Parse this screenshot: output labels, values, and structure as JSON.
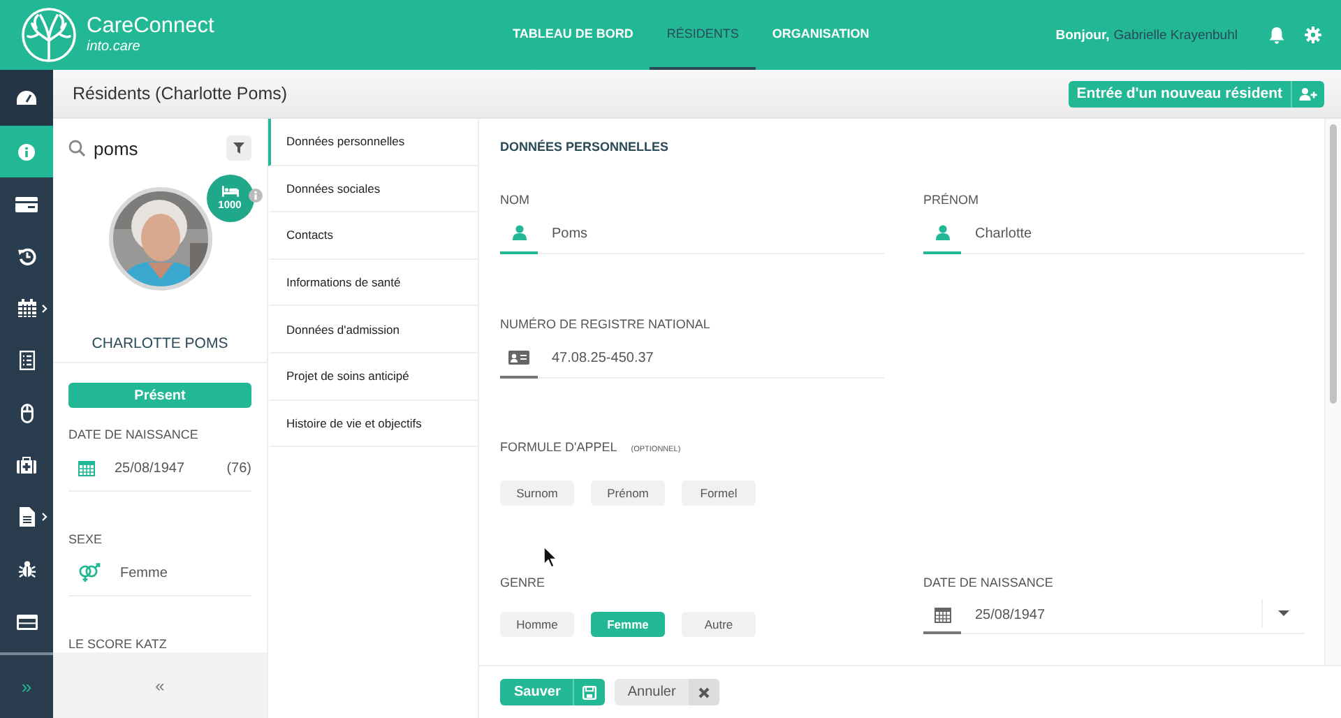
{
  "header": {
    "brand": "CareConnect",
    "tagline": "into.care",
    "nav": [
      {
        "label": "TABLEAU DE BORD",
        "selected": false
      },
      {
        "label": "RÉSIDENTS",
        "selected": true
      },
      {
        "label": "ORGANISATION",
        "selected": false
      }
    ],
    "greeting": "Bonjour,",
    "user": "Gabrielle Krayenbuhl"
  },
  "rail": {
    "items": [
      {
        "kind": "dashboard",
        "selected": false,
        "submenu": false
      },
      {
        "kind": "info",
        "selected": true,
        "submenu": false
      },
      {
        "kind": "card",
        "selected": false,
        "submenu": false
      },
      {
        "kind": "history",
        "selected": false,
        "submenu": false
      },
      {
        "kind": "calendar",
        "selected": false,
        "submenu": true
      },
      {
        "kind": "checklist",
        "selected": false,
        "submenu": false
      },
      {
        "kind": "mouse",
        "selected": false,
        "submenu": false
      },
      {
        "kind": "medkit",
        "selected": false,
        "submenu": false
      },
      {
        "kind": "document",
        "selected": false,
        "submenu": true
      },
      {
        "kind": "bug",
        "selected": false,
        "submenu": false
      },
      {
        "kind": "panel",
        "selected": false,
        "submenu": false
      }
    ],
    "expand": "»"
  },
  "page": {
    "title": "Résidents (Charlotte Poms)",
    "new_resident": "Entrée d'un nouveau résident"
  },
  "resident_panel": {
    "search": "poms",
    "room": "1000",
    "name": "CHARLOTTE POMS",
    "status": "Présent",
    "fields": [
      {
        "kind": "date",
        "label": "DATE DE NAISSANCE",
        "value": "25/08/1947",
        "age": "(76)"
      },
      {
        "kind": "gender",
        "label": "SEXE",
        "value": "Femme"
      },
      {
        "label": "LE SCORE KATZ"
      }
    ],
    "collapse": "«"
  },
  "sections": [
    {
      "label": "Données personnelles",
      "selected": true
    },
    {
      "label": "Données sociales",
      "selected": false
    },
    {
      "label": "Contacts",
      "selected": false
    },
    {
      "label": "Informations de santé",
      "selected": false
    },
    {
      "label": "Données d'admission",
      "selected": false
    },
    {
      "label": "Projet de soins anticipé",
      "selected": false
    },
    {
      "label": "Histoire de vie et objectifs",
      "selected": false
    }
  ],
  "form": {
    "title": "DONNÉES PERSONNELLES",
    "name_fields": [
      {
        "label": "NOM",
        "value": "Poms"
      },
      {
        "label": "PRÉNOM",
        "value": "Charlotte"
      }
    ],
    "registry": {
      "label": "NUMÉRO DE REGISTRE NATIONAL",
      "value": "47.08.25-450.37"
    },
    "salutation": {
      "label": "FORMULE D'APPEL",
      "note": "(OPTIONNEL)",
      "options": [
        {
          "label": "Surnom",
          "selected": false
        },
        {
          "label": "Prénom",
          "selected": false
        },
        {
          "label": "Formel",
          "selected": false
        }
      ]
    },
    "gender": {
      "label": "GENRE",
      "options": [
        {
          "label": "Homme",
          "selected": false
        },
        {
          "label": "Femme",
          "selected": true
        },
        {
          "label": "Autre",
          "selected": false
        }
      ]
    },
    "birth_date": {
      "label": "DATE DE NAISSANCE",
      "value": "25/08/1947"
    }
  },
  "footer": {
    "save": "Sauver",
    "cancel": "Annuler"
  }
}
